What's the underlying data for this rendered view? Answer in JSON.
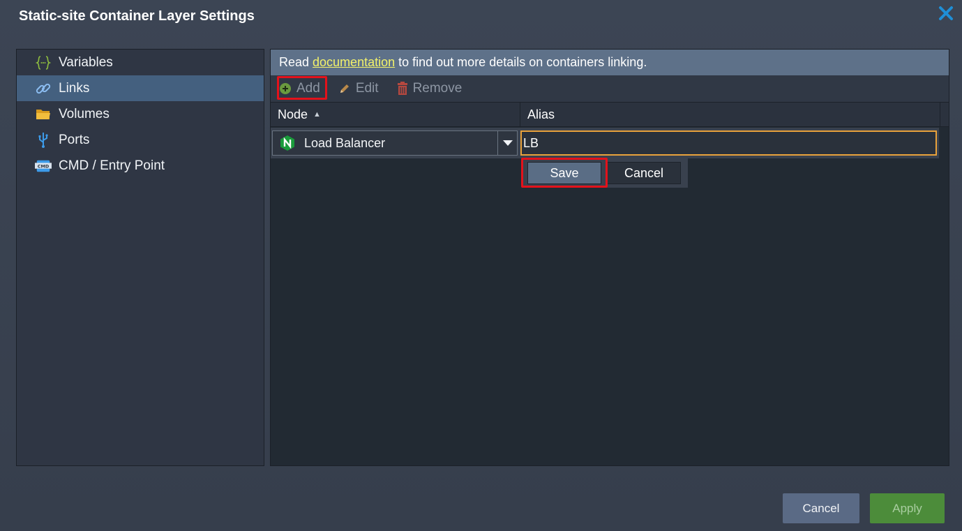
{
  "dialog": {
    "title": "Static-site Container Layer Settings"
  },
  "sidebar": {
    "items": [
      {
        "label": "Variables",
        "icon": "braces-icon"
      },
      {
        "label": "Links",
        "icon": "link-icon",
        "active": true
      },
      {
        "label": "Volumes",
        "icon": "folder-icon"
      },
      {
        "label": "Ports",
        "icon": "usb-icon"
      },
      {
        "label": "CMD / Entry Point",
        "icon": "cmd-icon"
      }
    ]
  },
  "info": {
    "prefix": "Read",
    "link": "documentation",
    "suffix": "to find out more details on containers linking."
  },
  "toolbar": {
    "add_label": "Add",
    "edit_label": "Edit",
    "remove_label": "Remove"
  },
  "grid": {
    "columns": [
      "Node",
      "Alias"
    ],
    "edit_row": {
      "node_value": "Load Balancer",
      "alias_value": "LB"
    },
    "save_label": "Save",
    "cancel_label": "Cancel"
  },
  "footer": {
    "cancel_label": "Cancel",
    "apply_label": "Apply"
  },
  "colors": {
    "accent": "#44607f",
    "highlight": "#e3121b",
    "focus": "#e9a23b",
    "apply": "#4c8c3a"
  }
}
